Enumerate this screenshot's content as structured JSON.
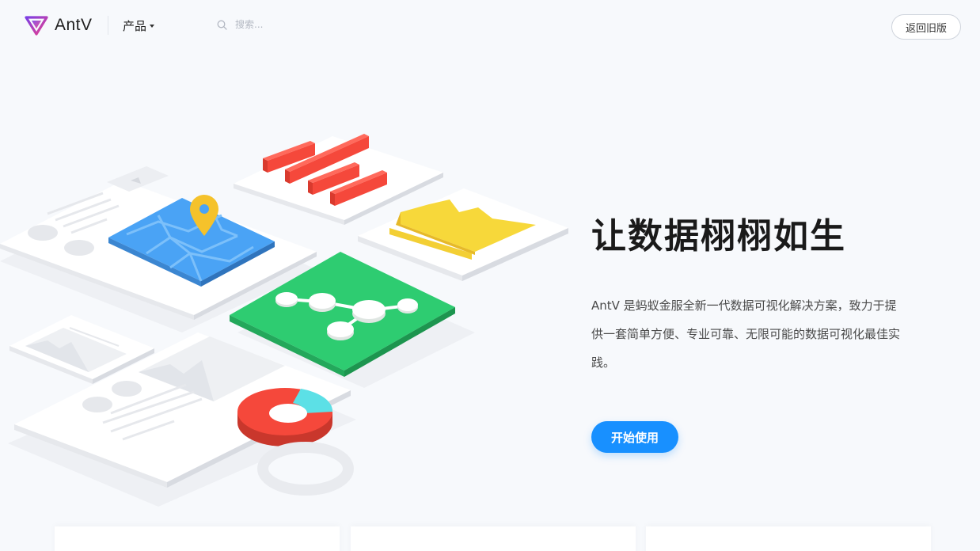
{
  "header": {
    "brand": "AntV",
    "products_label": "产品",
    "search_placeholder": "搜索...",
    "old_version_label": "返回旧版"
  },
  "hero": {
    "title": "让数据栩栩如生",
    "description": "AntV 是蚂蚁金服全新一代数据可视化解决方案，致力于提供一套简单方便、专业可靠、无限可能的数据可视化最佳实践。",
    "cta_label": "开始使用"
  },
  "colors": {
    "accent": "#1890ff",
    "map_blue": "#4aa3f5",
    "graph_green": "#2ecc71",
    "bar_red": "#f5483b",
    "area_yellow": "#f7d83a",
    "donut_cyan": "#5ce0e6"
  },
  "icons": {
    "logo": "antv-logo-icon",
    "search": "search-icon",
    "products_caret": "caret-down-icon"
  }
}
